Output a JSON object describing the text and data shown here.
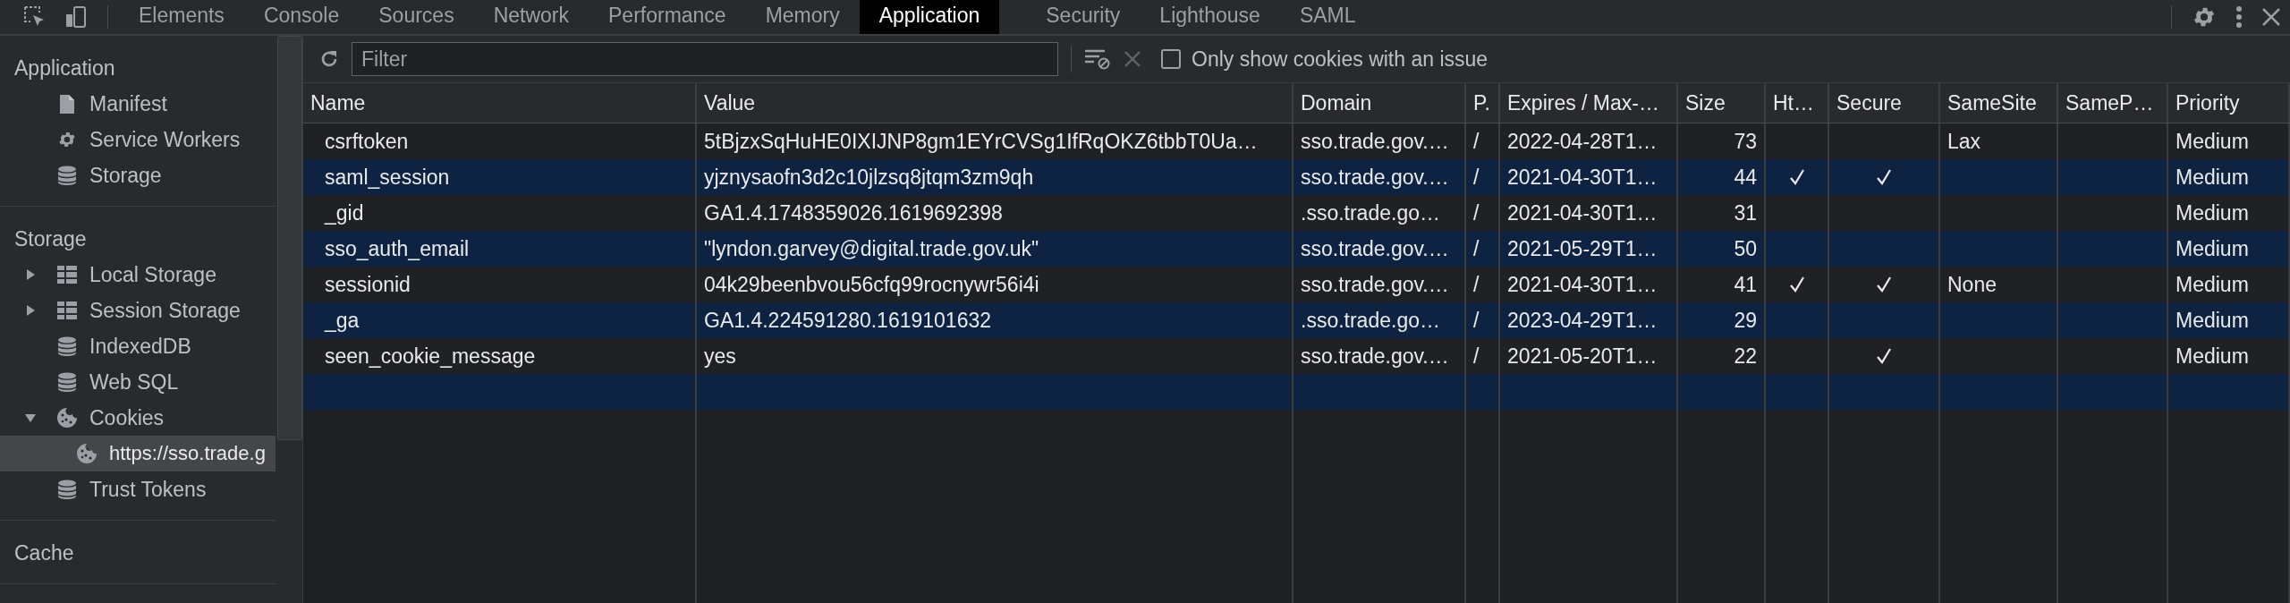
{
  "tabs": [
    {
      "label": "Elements",
      "selected": false
    },
    {
      "label": "Console",
      "selected": false
    },
    {
      "label": "Sources",
      "selected": false
    },
    {
      "label": "Network",
      "selected": false
    },
    {
      "label": "Performance",
      "selected": false
    },
    {
      "label": "Memory",
      "selected": false
    },
    {
      "label": "Application",
      "selected": true
    },
    {
      "label": "Security",
      "selected": false
    },
    {
      "label": "Lighthouse",
      "selected": false
    },
    {
      "label": "SAML",
      "selected": false
    }
  ],
  "sidebar": {
    "sections": [
      {
        "title": "Application",
        "items": [
          {
            "label": "Manifest",
            "kind": "file",
            "selected": false
          },
          {
            "label": "Service Workers",
            "kind": "gear",
            "selected": false
          },
          {
            "label": "Storage",
            "kind": "database",
            "selected": false
          }
        ]
      },
      {
        "title": "Storage",
        "items": [
          {
            "label": "Local Storage",
            "kind": "grid",
            "expanded": false,
            "selected": false
          },
          {
            "label": "Session Storage",
            "kind": "grid",
            "expanded": false,
            "selected": false
          },
          {
            "label": "IndexedDB",
            "kind": "database",
            "selected": false
          },
          {
            "label": "Web SQL",
            "kind": "database",
            "selected": false
          },
          {
            "label": "Cookies",
            "kind": "cookie",
            "expanded": true,
            "selected": false,
            "children": [
              {
                "label": "https://sso.trade.g",
                "kind": "cookie",
                "selected": true
              }
            ]
          },
          {
            "label": "Trust Tokens",
            "kind": "database",
            "selected": false
          }
        ]
      },
      {
        "title": "Cache"
      }
    ]
  },
  "toolbar": {
    "filter": {
      "placeholder": "Filter"
    },
    "issue_checkbox": {
      "label": "Only show cookies with an issue",
      "checked": false
    }
  },
  "table": {
    "columns": [
      "Name",
      "Value",
      "Domain",
      "P.",
      "Expires / Max-…",
      "Size",
      "Ht…",
      "Secure",
      "SameSite",
      "SameP…",
      "Priority"
    ],
    "rows": [
      {
        "name": "csrftoken",
        "value": "5tBjzxSqHuHE0IXIJNP8gm1EYrCVSg1IfRqOKZ6tbbT0Ua…",
        "domain": "sso.trade.gov.…",
        "path": "/",
        "expires": "2022-04-28T1…",
        "size": "73",
        "http_only": false,
        "secure": false,
        "samesite": "Lax",
        "priority": "Medium"
      },
      {
        "name": "saml_session",
        "value": "yjznysaofn3d2c10jlzsq8jtqm3zm9qh",
        "domain": "sso.trade.gov.…",
        "path": "/",
        "expires": "2021-04-30T1…",
        "size": "44",
        "http_only": true,
        "secure": true,
        "priority": "Medium"
      },
      {
        "name": "_gid",
        "value": "GA1.4.1748359026.1619692398",
        "domain": ".sso.trade.go…",
        "path": "/",
        "expires": "2021-04-30T1…",
        "size": "31",
        "http_only": false,
        "secure": false,
        "priority": "Medium"
      },
      {
        "name": "sso_auth_email",
        "value": "\"lyndon.garvey@digital.trade.gov.uk\"",
        "domain": "sso.trade.gov.…",
        "path": "/",
        "expires": "2021-05-29T1…",
        "size": "50",
        "http_only": false,
        "secure": false,
        "priority": "Medium"
      },
      {
        "name": "sessionid",
        "value": "04k29beenbvou56cfq99rocnywr56i4i",
        "domain": "sso.trade.gov.…",
        "path": "/",
        "expires": "2021-04-30T1…",
        "size": "41",
        "http_only": true,
        "secure": true,
        "samesite": "None",
        "priority": "Medium"
      },
      {
        "name": "_ga",
        "value": "GA1.4.224591280.1619101632",
        "domain": ".sso.trade.go…",
        "path": "/",
        "expires": "2023-04-29T1…",
        "size": "29",
        "http_only": false,
        "secure": false,
        "priority": "Medium"
      },
      {
        "name": "seen_cookie_message",
        "value": "yes",
        "domain": "sso.trade.gov.…",
        "path": "/",
        "expires": "2021-05-20T1…",
        "size": "22",
        "http_only": false,
        "secure": true,
        "priority": "Medium"
      }
    ]
  }
}
